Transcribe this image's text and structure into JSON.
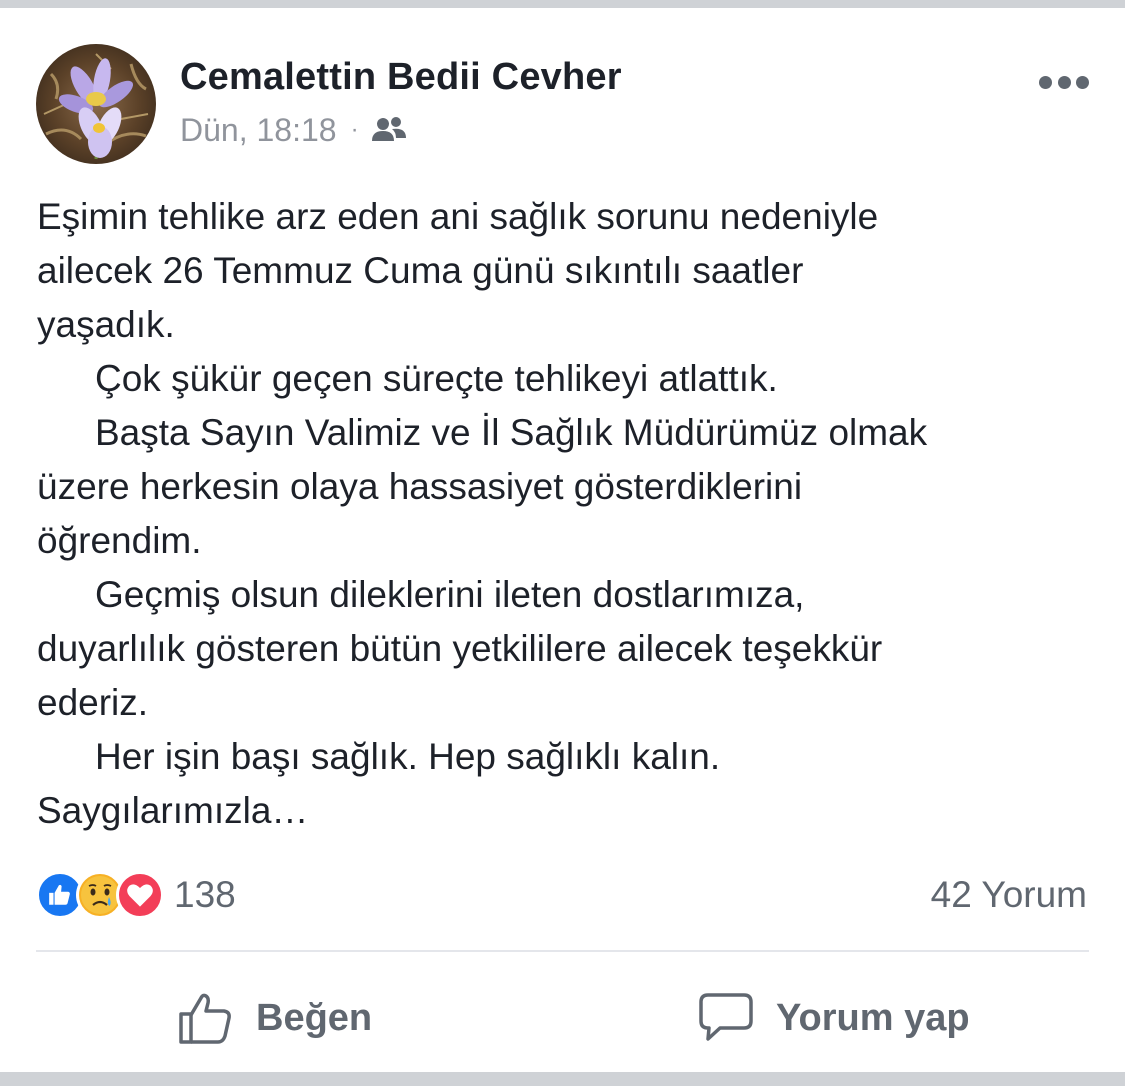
{
  "post": {
    "author": "Cemalettin Bedii Cevher",
    "time": "Dün, 18:18",
    "separator": "·",
    "audience_icon": "friends-icon",
    "more_icon": "more-dots-icon",
    "body_lines": [
      "Eşimin tehlike arz eden ani sağlık sorunu nedeniyle",
      "ailecek 26 Temmuz Cuma günü sıkıntılı saatler",
      "yaşadık.",
      "Çok şükür geçen süreçte tehlikeyi atlattık.",
      "Başta Sayın Valimiz ve İl Sağlık Müdürümüz olmak",
      "üzere herkesin olaya hassasiyet gösterdiklerini",
      "öğrendim.",
      "Geçmiş olsun dileklerini ileten dostlarımıza,",
      "duyarlılık gösteren bütün yetkililere ailecek teşekkür",
      "ederiz.",
      "Her işin başı sağlık. Hep sağlıklı kalın.",
      "Saygılarımızla…"
    ]
  },
  "reactions": {
    "icons": [
      "like-reaction-icon",
      "sad-reaction-icon",
      "love-reaction-icon"
    ],
    "count": "138",
    "comments": "42 Yorum"
  },
  "actions": {
    "like_label": "Beğen",
    "comment_label": "Yorum yap"
  },
  "colors": {
    "text": "#1d2129",
    "secondary": "#606770",
    "meta": "#90949c",
    "like_blue": "#1877f2",
    "love_red": "#f33e58",
    "sad_yellow": "#f7b125"
  }
}
